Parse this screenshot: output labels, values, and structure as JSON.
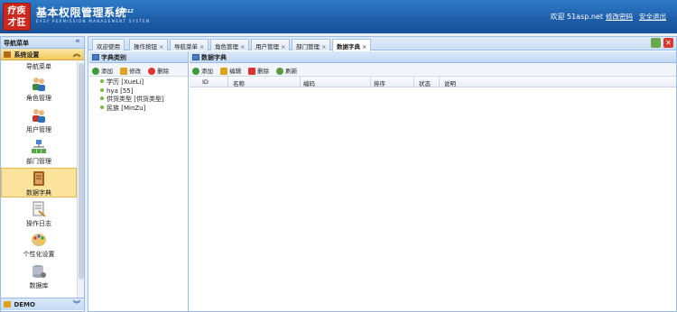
{
  "header": {
    "logo_text": "疗疾才狂",
    "title": "基本权限管理系统",
    "version": "2012",
    "subtitle": "EASY PERMISSION MANAGEMENT SYSTEM",
    "welcome": "欢迎 51asp.net",
    "change_password": "修改密码",
    "logout": "安全退出"
  },
  "sidebar": {
    "title": "导航菜单",
    "collapse_icon": "«",
    "group_system": "系统设置",
    "group_demo": "DEMO",
    "items": [
      {
        "label": "导航菜单",
        "icon": "menu-icon"
      },
      {
        "label": "角色管理",
        "icon": "role-icon"
      },
      {
        "label": "用户管理",
        "icon": "user-icon"
      },
      {
        "label": "部门管理",
        "icon": "department-icon"
      },
      {
        "label": "数据字典",
        "icon": "dictionary-icon",
        "active": true
      },
      {
        "label": "操作日志",
        "icon": "log-icon"
      },
      {
        "label": "个性化设置",
        "icon": "palette-icon"
      },
      {
        "label": "数据库",
        "icon": "database-icon"
      }
    ]
  },
  "tabs": [
    {
      "label": "欢迎使用",
      "closable": false
    },
    {
      "label": "操作按钮",
      "closable": true
    },
    {
      "label": "导航菜单",
      "closable": true
    },
    {
      "label": "角色管理",
      "closable": true
    },
    {
      "label": "用户管理",
      "closable": true
    },
    {
      "label": "部门管理",
      "closable": true
    },
    {
      "label": "数据字典",
      "closable": true,
      "active": true
    }
  ],
  "category_panel": {
    "title": "字典类别",
    "buttons": {
      "add": "添加",
      "edit": "修改",
      "delete": "删除"
    },
    "tree": [
      "学历 [XueLi]",
      "hya [55]",
      "供货类型 [供货类型]",
      "民族 [MinZu]"
    ]
  },
  "dict_panel": {
    "title": "数据字典",
    "buttons": {
      "add": "添加",
      "edit": "编辑",
      "delete": "删除",
      "refresh": "刷新"
    },
    "columns": [
      "ID",
      "名称",
      "编码",
      "排序",
      "状态",
      "说明"
    ]
  },
  "colors": {
    "header": "#1f5faa",
    "active": "#fbe39c",
    "border": "#99bbe8"
  }
}
